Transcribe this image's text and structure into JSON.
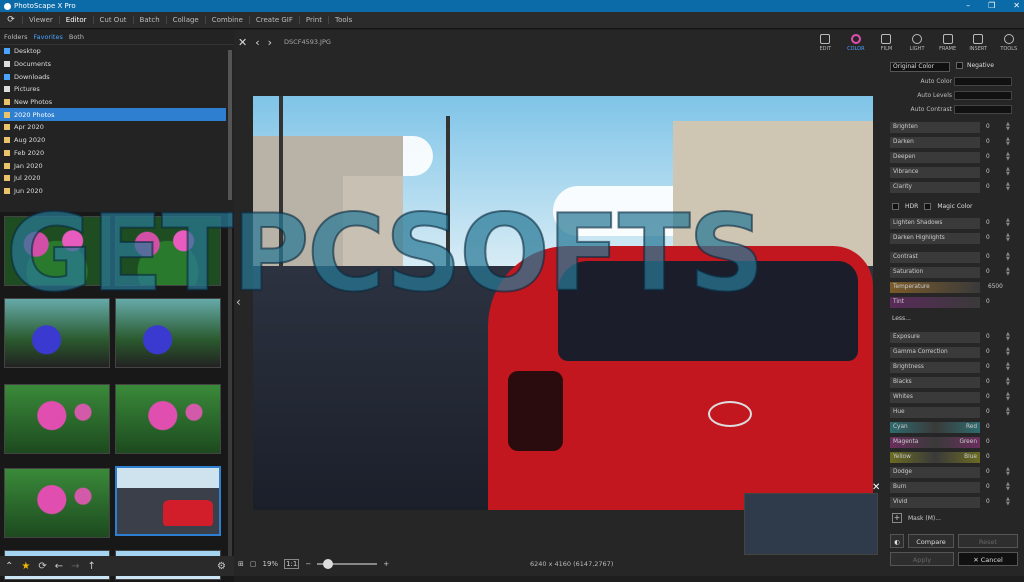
{
  "window": {
    "title": "PhotoScape X Pro",
    "controls": [
      "–",
      "❐",
      "✕"
    ]
  },
  "menu": {
    "items": [
      "Viewer",
      "Editor",
      "Cut Out",
      "Batch",
      "Collage",
      "Combine",
      "Create GIF",
      "Print",
      "Tools"
    ],
    "active": "Editor"
  },
  "browser": {
    "tabs": [
      "Folders",
      "Favorites",
      "Both"
    ],
    "active_tab": "Favorites",
    "folders": [
      "Desktop",
      "Documents",
      "Downloads",
      "Pictures",
      "New Photos",
      "2020 Photos",
      "Apr 2020",
      "Aug 2020",
      "Feb 2020",
      "Jan 2020",
      "Jul 2020",
      "Jun 2020"
    ],
    "selected_folder": "2020 Photos"
  },
  "viewer": {
    "filename": "DSCF4593.JPG",
    "zoom": "19%",
    "zoom_fit": "1:1",
    "dimensions": "6240 x 4160 (6147,2767)"
  },
  "watermark": "GETPCSOFTS",
  "toolbar": [
    "EDIT",
    "COLOR",
    "FILM",
    "LIGHT",
    "FRAME",
    "INSERT",
    "TOOLS"
  ],
  "active_tool": "COLOR",
  "panel": {
    "mode_select": "Original Color",
    "negative_label": "Negative",
    "auto": [
      "Auto Color",
      "Auto Levels",
      "Auto Contrast"
    ],
    "sliders1": [
      {
        "label": "Brighten",
        "value": "0"
      },
      {
        "label": "Darken",
        "value": "0"
      },
      {
        "label": "Deepen",
        "value": "0"
      },
      {
        "label": "Vibrance",
        "value": "0"
      },
      {
        "label": "Clarity",
        "value": "0"
      }
    ],
    "hdr_label": "HDR",
    "magic_label": "Magic Color",
    "sliders2": [
      {
        "label": "Lighten Shadows",
        "value": "0"
      },
      {
        "label": "Darken Highlights",
        "value": "0"
      },
      {
        "label": "Contrast",
        "value": "0"
      },
      {
        "label": "Saturation",
        "value": "0"
      },
      {
        "label": "Temperature",
        "value": "6500"
      },
      {
        "label": "Tint",
        "value": "0"
      }
    ],
    "less_label": "Less...",
    "sliders3": [
      {
        "label": "Exposure",
        "value": "0"
      },
      {
        "label": "Gamma Correction",
        "value": "0"
      },
      {
        "label": "Brightness",
        "value": "0"
      },
      {
        "label": "Blacks",
        "value": "0"
      },
      {
        "label": "Whites",
        "value": "0"
      },
      {
        "label": "Hue",
        "value": "0"
      }
    ],
    "balance": [
      {
        "left": "Cyan",
        "right": "Red",
        "value": "0",
        "color": "#2e6b6e"
      },
      {
        "left": "Magenta",
        "right": "Green",
        "value": "0",
        "color": "#6b2e5e"
      },
      {
        "left": "Yellow",
        "right": "Blue",
        "value": "0",
        "color": "#6b6b22"
      }
    ],
    "sliders4": [
      {
        "label": "Dodge",
        "value": "0"
      },
      {
        "label": "Burn",
        "value": "0"
      },
      {
        "label": "Vivid",
        "value": "0"
      }
    ],
    "mask_label": "Mask (M)...",
    "compare_label": "Compare",
    "reset_label": "Reset",
    "apply_label": "Apply",
    "cancel_label": "Cancel"
  }
}
